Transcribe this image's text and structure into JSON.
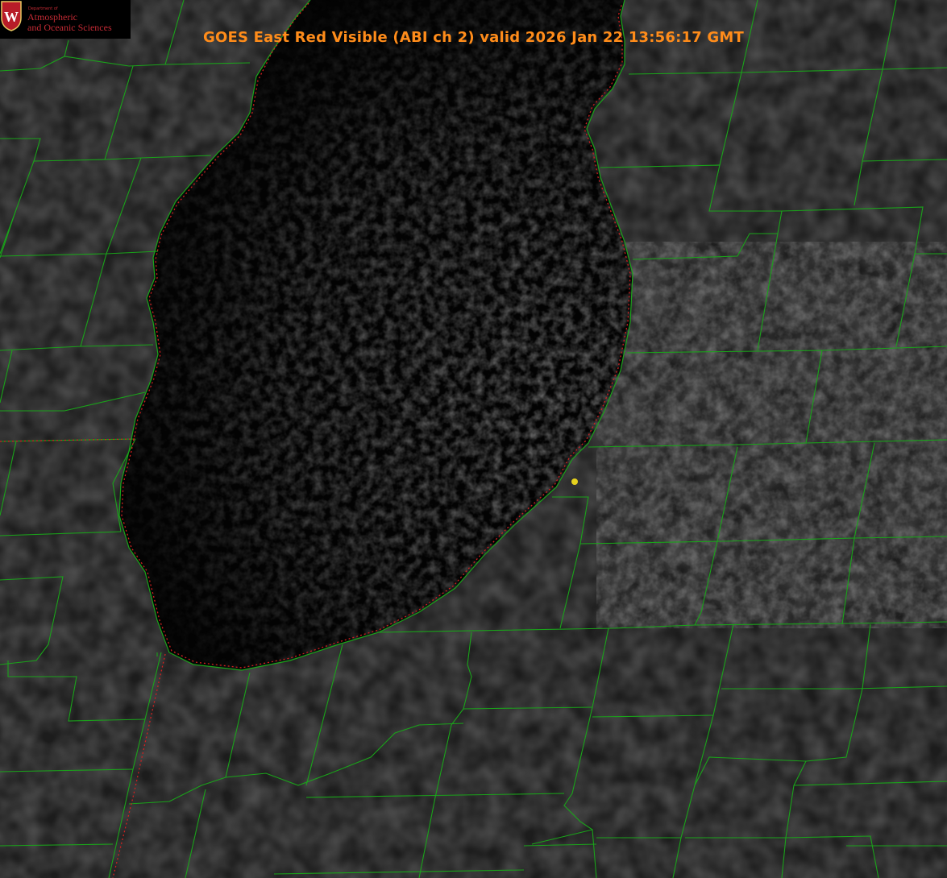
{
  "title": "GOES East Red Visible (ABI ch 2) valid 2026 Jan 22 13:56:17 GMT",
  "logo": {
    "department": "Department of",
    "line1": "Atmospheric",
    "line2": "and Oceanic Sciences",
    "crest_letter": "W"
  },
  "colors": {
    "title": "#ff8c1a",
    "county_lines": "#1aa31a",
    "state_line": "#d02020",
    "marker": "#e6d21e",
    "logo_text": "#c42a34"
  }
}
